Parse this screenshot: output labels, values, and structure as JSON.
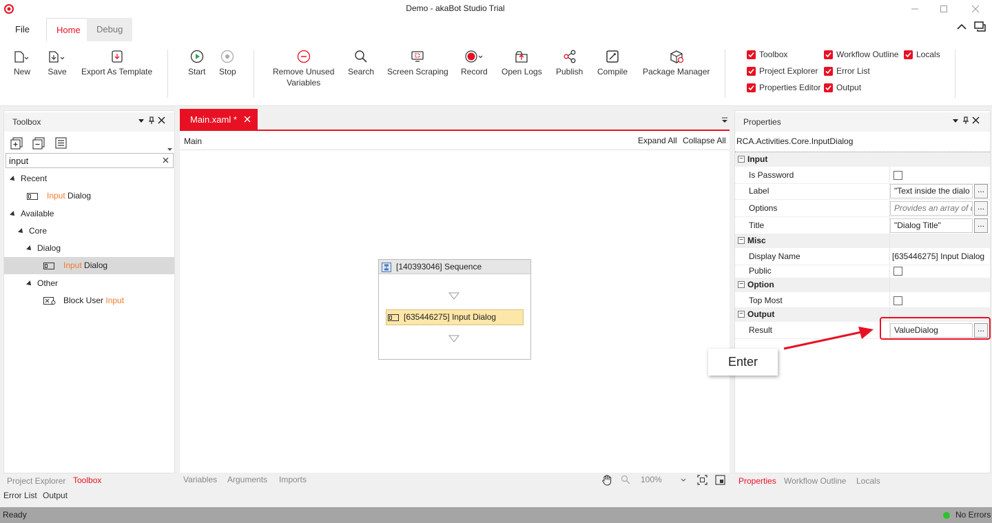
{
  "window": {
    "title": "Demo - akaBot Studio Trial"
  },
  "menu_tabs": [
    {
      "label": "File"
    },
    {
      "label": "Home"
    },
    {
      "label": "Debug"
    }
  ],
  "ribbon": {
    "buttons": [
      {
        "label": "New"
      },
      {
        "label": "Save"
      },
      {
        "label": "Export As Template"
      },
      {
        "label": "Start"
      },
      {
        "label": "Stop"
      },
      {
        "label": "Remove Unused\nVariables"
      },
      {
        "label": "Search"
      },
      {
        "label": "Screen Scraping"
      },
      {
        "label": "Record"
      },
      {
        "label": "Open Logs"
      },
      {
        "label": "Publish"
      },
      {
        "label": "Compile"
      },
      {
        "label": "Package Manager"
      }
    ],
    "checks": [
      {
        "label": "Toolbox"
      },
      {
        "label": "Workflow Outline"
      },
      {
        "label": "Locals"
      },
      {
        "label": "Project Explorer"
      },
      {
        "label": "Error List"
      },
      {
        "label": "Properties Editor"
      },
      {
        "label": "Output"
      }
    ]
  },
  "toolbox": {
    "title": "Toolbox",
    "search_value": "input",
    "tree": {
      "recent": "Recent",
      "recent_item_hl": "Input",
      "recent_item_rest": " Dialog",
      "available": "Available",
      "core": "Core",
      "dialog": "Dialog",
      "dialog_item_hl": "Input",
      "dialog_item_rest": " Dialog",
      "other": "Other",
      "other_item_rest": "Block User ",
      "other_item_hl": "Input"
    },
    "bottom_tabs": [
      "Project Explorer",
      "Toolbox"
    ],
    "bottom_tabs2": [
      "Error List",
      "Output"
    ]
  },
  "designer": {
    "tab_label": "Main.xaml *",
    "breadcrumb": "Main",
    "expand_all": "Expand All",
    "collapse_all": "Collapse All",
    "sequence_title": "[140393046] Sequence",
    "activity_title": "[635446275] Input Dialog",
    "bottom_tabs": [
      "Variables",
      "Arguments",
      "Imports"
    ],
    "zoom": "100%"
  },
  "properties": {
    "title": "Properties",
    "type_name": "RCA.Activities.Core.InputDialog",
    "cat_input": "Input",
    "is_password": "Is Password",
    "label_name": "Label",
    "label_value": "\"Text inside the dialo",
    "options_name": "Options",
    "options_placeholder": "Provides an array of c",
    "title_name": "Title",
    "title_value": "\"Dialog Title\"",
    "cat_misc": "Misc",
    "display_name": "Display Name",
    "display_value": "[635446275] Input Dialog",
    "public_name": "Public",
    "cat_option": "Option",
    "top_most": "Top Most",
    "cat_output": "Output",
    "result_name": "Result",
    "result_value": "ValueDialog",
    "ellipsis": "...",
    "bottom_tabs": [
      "Properties",
      "Workflow Outline",
      "Locals"
    ]
  },
  "callout": {
    "text": "Enter"
  },
  "status": {
    "left": "Ready",
    "right": "No Errors"
  },
  "colors": {
    "accent": "#e81123",
    "status_bg": "#a5a5a5",
    "activity_bg": "#fce7a8"
  }
}
